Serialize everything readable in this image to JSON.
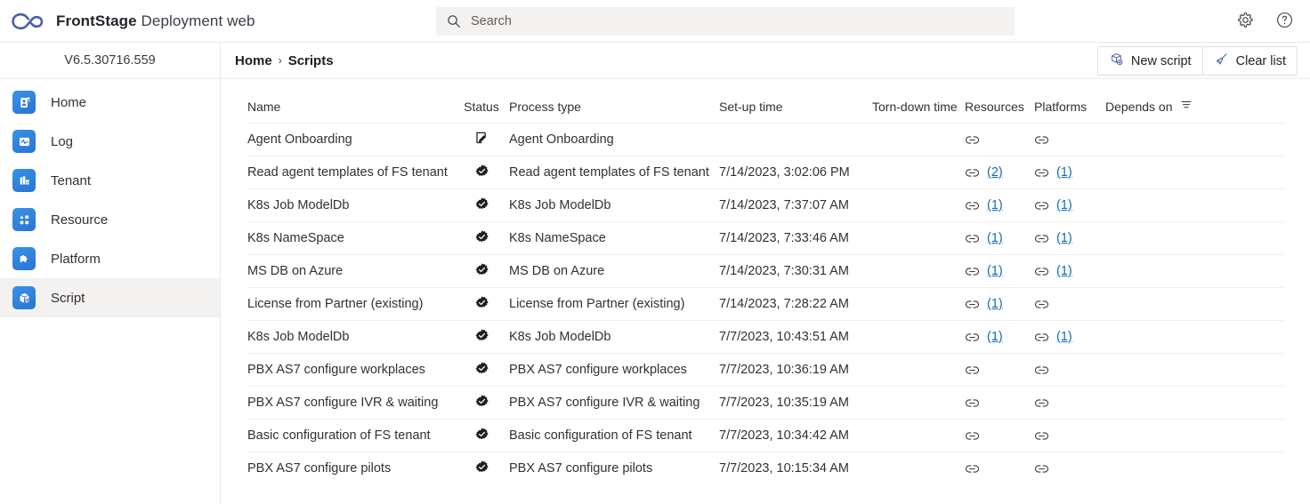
{
  "header": {
    "brand_strong": "FrontStage",
    "brand_rest": " Deployment web",
    "logo_icon": "infinity-logo",
    "search": {
      "placeholder": "Search",
      "value": "",
      "icon": "search-icon"
    },
    "settings_icon": "gear-icon",
    "help_icon": "help-circle-icon"
  },
  "sidebar": {
    "version": "V6.5.30716.559",
    "items": [
      {
        "label": "Home",
        "icon": "home-clipboard-icon",
        "active": false
      },
      {
        "label": "Log",
        "icon": "log-pulse-icon",
        "active": false
      },
      {
        "label": "Tenant",
        "icon": "tenant-building-icon",
        "active": false
      },
      {
        "label": "Resource",
        "icon": "resource-shapes-icon",
        "active": false
      },
      {
        "label": "Platform",
        "icon": "platform-puzzle-icon",
        "active": false
      },
      {
        "label": "Script",
        "icon": "script-box-icon",
        "active": true
      }
    ]
  },
  "breadcrumb": {
    "root": "Home",
    "separator": "›",
    "current": "Scripts"
  },
  "toolbar": {
    "new_script_label": "New script",
    "new_script_icon": "box-add-icon",
    "clear_list_label": "Clear list",
    "clear_list_icon": "broom-icon"
  },
  "table": {
    "columns": [
      "Name",
      "Status",
      "Process type",
      "Set-up time",
      "Torn-down time",
      "Resources",
      "Platforms",
      "Depends on"
    ],
    "sort_icon": "sort-descending-icon",
    "rows": [
      {
        "name": "Agent Onboarding",
        "status": "draft",
        "process_type": "Agent Onboarding",
        "setup_time": "",
        "torn_down_time": "",
        "resources": "",
        "platforms": "",
        "depends_on": ""
      },
      {
        "name": "Read agent templates of FS tenant",
        "status": "done",
        "process_type": "Read agent templates of FS tenant",
        "setup_time": "7/14/2023, 3:02:06 PM",
        "torn_down_time": "",
        "resources": "(2)",
        "platforms": "(1)",
        "depends_on": ""
      },
      {
        "name": "K8s Job ModelDb",
        "status": "done",
        "process_type": "K8s Job ModelDb",
        "setup_time": "7/14/2023, 7:37:07 AM",
        "torn_down_time": "",
        "resources": "(1)",
        "platforms": "(1)",
        "depends_on": ""
      },
      {
        "name": "K8s NameSpace",
        "status": "done",
        "process_type": "K8s NameSpace",
        "setup_time": "7/14/2023, 7:33:46 AM",
        "torn_down_time": "",
        "resources": "(1)",
        "platforms": "(1)",
        "depends_on": ""
      },
      {
        "name": "MS DB on Azure",
        "status": "done",
        "process_type": "MS DB on Azure",
        "setup_time": "7/14/2023, 7:30:31 AM",
        "torn_down_time": "",
        "resources": "(1)",
        "platforms": "(1)",
        "depends_on": ""
      },
      {
        "name": "License from Partner (existing)",
        "status": "done",
        "process_type": "License from Partner (existing)",
        "setup_time": "7/14/2023, 7:28:22 AM",
        "torn_down_time": "",
        "resources": "(1)",
        "platforms": "",
        "depends_on": ""
      },
      {
        "name": "K8s Job ModelDb",
        "status": "done",
        "process_type": "K8s Job ModelDb",
        "setup_time": "7/7/2023, 10:43:51 AM",
        "torn_down_time": "",
        "resources": "(1)",
        "platforms": "(1)",
        "depends_on": ""
      },
      {
        "name": "PBX AS7 configure workplaces",
        "status": "done",
        "process_type": "PBX AS7 configure workplaces",
        "setup_time": "7/7/2023, 10:36:19 AM",
        "torn_down_time": "",
        "resources": "",
        "platforms": "",
        "depends_on": ""
      },
      {
        "name": "PBX AS7 configure IVR & waiting",
        "status": "done",
        "process_type": "PBX AS7 configure IVR & waiting",
        "setup_time": "7/7/2023, 10:35:19 AM",
        "torn_down_time": "",
        "resources": "",
        "platforms": "",
        "depends_on": ""
      },
      {
        "name": "Basic configuration of FS tenant",
        "status": "done",
        "process_type": "Basic configuration of FS tenant",
        "setup_time": "7/7/2023, 10:34:42 AM",
        "torn_down_time": "",
        "resources": "",
        "platforms": "",
        "depends_on": ""
      },
      {
        "name": "PBX AS7 configure pilots",
        "status": "done",
        "process_type": "PBX AS7 configure pilots",
        "setup_time": "7/7/2023, 10:15:34 AM",
        "torn_down_time": "",
        "resources": "",
        "platforms": "",
        "depends_on": ""
      }
    ]
  },
  "colors": {
    "accent_blue": "#0f6cbd",
    "logo_blue": "#4a5fa5",
    "icon_gradient_from": "#3793e6",
    "icon_gradient_to": "#2a73d4",
    "status_done": "#201f1e",
    "divider": "#edebe9"
  }
}
